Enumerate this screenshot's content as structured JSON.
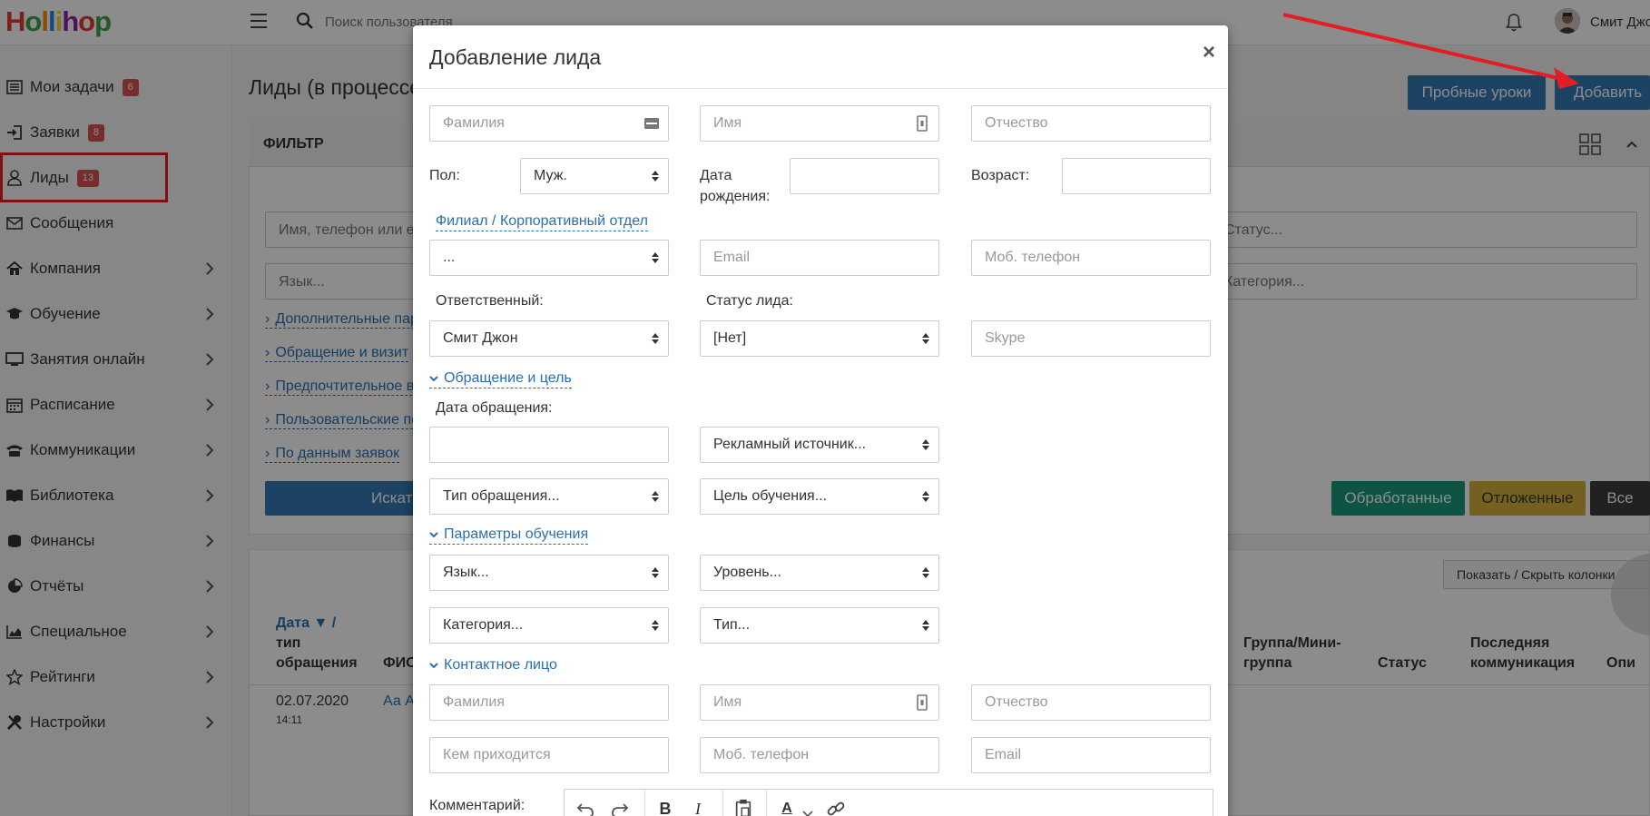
{
  "topbar": {
    "logo": "Hollihop",
    "logo_colors": [
      "#e53935",
      "#43a047",
      "#fb8c00",
      "#1e88e5",
      "#fdd835",
      "#8e24aa",
      "#e53935",
      "#43a047"
    ],
    "search_placeholder": "Поиск пользователя",
    "username": "Смит Джон"
  },
  "sidebar": {
    "items": [
      {
        "label": "Мои задачи",
        "badge": "6",
        "icon": "list-icon"
      },
      {
        "label": "Заявки",
        "badge": "8",
        "icon": "sign-in-icon"
      },
      {
        "label": "Лиды",
        "badge": "13",
        "icon": "user-icon"
      },
      {
        "label": "Сообщения",
        "icon": "envelope-icon"
      },
      {
        "label": "Компания",
        "icon": "home-icon"
      },
      {
        "label": "Обучение",
        "icon": "graduation-cap-icon"
      },
      {
        "label": "Занятия онлайн",
        "icon": "monitor-icon"
      },
      {
        "label": "Расписание",
        "icon": "calendar-icon"
      },
      {
        "label": "Коммуникации",
        "icon": "phone-icon"
      },
      {
        "label": "Библиотека",
        "icon": "book-icon"
      },
      {
        "label": "Финансы",
        "icon": "coins-icon"
      },
      {
        "label": "Отчёты",
        "icon": "pie-chart-icon"
      },
      {
        "label": "Специальное",
        "icon": "area-chart-icon"
      },
      {
        "label": "Рейтинги",
        "icon": "star-icon"
      },
      {
        "label": "Настройки",
        "icon": "tools-icon"
      }
    ]
  },
  "main": {
    "title": "Лиды (в процессе)",
    "filter_title": "ФИЛЬТР",
    "trial_button": "Пробные уроки",
    "add_button": "Добавить",
    "search_placeholder": "Имя, телефон или e-mail",
    "status_select": "Статус...",
    "language_select": "Язык...",
    "category_select": "Категория...",
    "links": [
      "Дополнительные параметры",
      "Обращение и визит",
      "Предпочтительное время",
      "Пользовательские поля",
      "По данным заявок"
    ],
    "search_button": "Искать",
    "processed_button": "Обработанные",
    "postponed_button": "Отложенные",
    "all_button": "Все",
    "toggle_columns_button": "Показать / Скрыть колонки",
    "table": {
      "col_date_1": "Дата ▼ /",
      "col_date_2": "тип",
      "col_date_3": "обращения",
      "col_fio": "ФИО",
      "col_group_1": "Группа/Мини-",
      "col_group_2": "группа",
      "col_status": "Статус",
      "col_last_1": "Последняя",
      "col_last_2": "коммуникация",
      "col_desc": "Опи",
      "row_date": "02.07.2020",
      "row_time": "14:11",
      "row_name": "Аа А"
    }
  },
  "modal": {
    "title": "Добавление лида",
    "close": "×",
    "last_name": "Фамилия",
    "first_name": "Имя",
    "middle_name": "Отчество",
    "gender_label": "Пол:",
    "gender_value": "Муж.",
    "birth_label_1": "Дата",
    "birth_label_2": "рождения:",
    "age_label": "Возраст:",
    "branch_link": "Филиал / Корпоративный отдел",
    "branch_value": "...",
    "email": "Email",
    "mobile": "Моб. телефон",
    "responsible_label": "Ответственный:",
    "responsible_value": "Смит Джон",
    "lead_status_label": "Статус лида:",
    "lead_status_value": "[Нет]",
    "skype": "Skype",
    "section_appeal": "Обращение и цель",
    "appeal_date_label": "Дата обращения:",
    "ad_source": "Рекламный источник...",
    "appeal_type": "Тип обращения...",
    "study_goal": "Цель обучения...",
    "section_params": "Параметры обучения",
    "language": "Язык...",
    "level": "Уровень...",
    "category": "Категория...",
    "type": "Тип...",
    "section_contact": "Контактное лицо",
    "contact_last_name": "Фамилия",
    "contact_first_name": "Имя",
    "contact_middle_name": "Отчество",
    "contact_relation": "Кем приходится",
    "contact_mobile": "Моб. телефон",
    "contact_email": "Email",
    "comment_label": "Комментарий:"
  },
  "colors": {
    "primary": "#337ab7",
    "success": "#1a9a7f",
    "warning": "#d6b13a",
    "dark": "#3c3c3c",
    "link": "#2a6fb0",
    "badge": "#d9534f",
    "annotation_red": "#e51c23"
  }
}
